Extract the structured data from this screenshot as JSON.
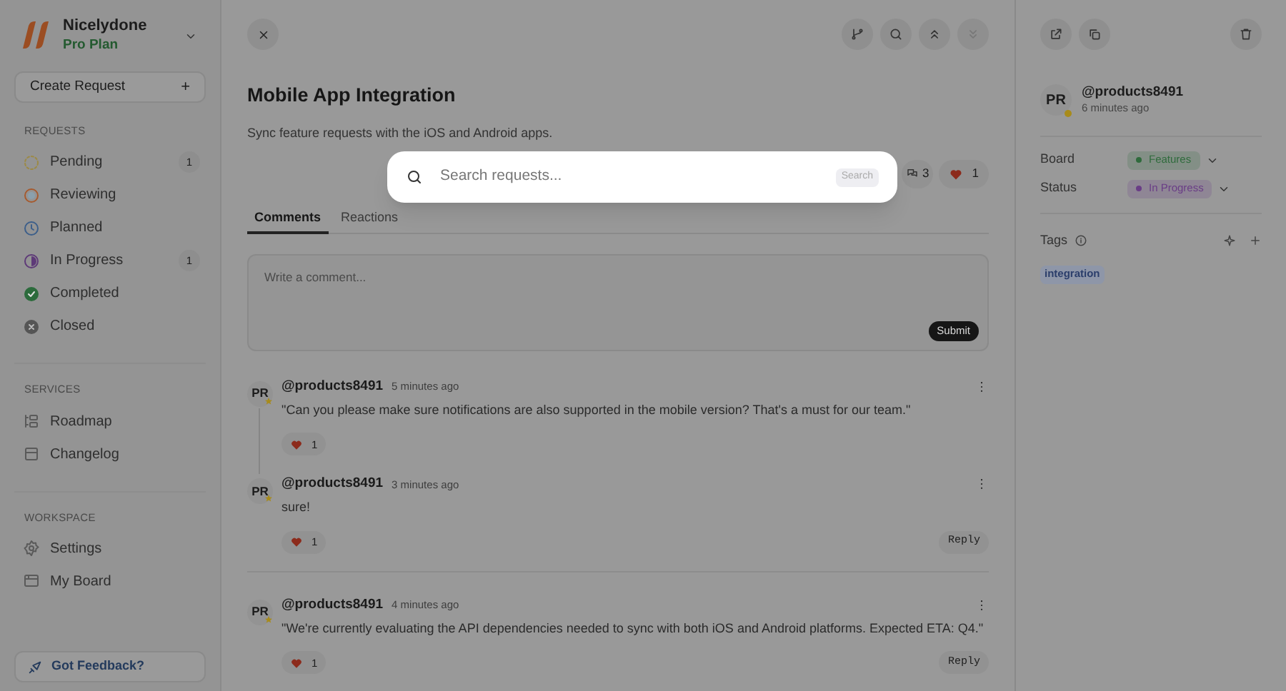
{
  "workspace": {
    "name": "Nicelydone",
    "plan": "Pro Plan"
  },
  "create_button": {
    "label": "Create Request",
    "icon": "+"
  },
  "sections": [
    {
      "title": "REQUESTS",
      "items": [
        {
          "label": "Pending",
          "kind": "pending",
          "count": "1"
        },
        {
          "label": "Reviewing",
          "kind": "reviewing"
        },
        {
          "label": "Planned",
          "kind": "planned"
        },
        {
          "label": "In Progress",
          "kind": "progress",
          "count": "1"
        },
        {
          "label": "Completed",
          "kind": "completed"
        },
        {
          "label": "Closed",
          "kind": "closed"
        }
      ]
    },
    {
      "title": "SERVICES",
      "items": [
        {
          "label": "Roadmap",
          "kind": "roadmap"
        },
        {
          "label": "Changelog",
          "kind": "changelog"
        }
      ]
    },
    {
      "title": "WORKSPACE",
      "items": [
        {
          "label": "Settings",
          "kind": "settings"
        },
        {
          "label": "My Board",
          "kind": "board"
        }
      ]
    }
  ],
  "feedback": "Got Feedback?",
  "request": {
    "title": "Mobile App Integration",
    "description": "Sync feature requests with the iOS and Android apps.",
    "comment_count": "3",
    "likes": "1"
  },
  "tabs": [
    {
      "label": "Comments",
      "selected": true
    },
    {
      "label": "Reactions",
      "selected": false
    }
  ],
  "comment_box": {
    "placeholder": "Write a comment...",
    "submit": "Submit"
  },
  "comments": [
    {
      "avatar": "PR",
      "author": "@products8491",
      "time": "5 minutes ago",
      "text": "\"Can you please make sure notifications are also supported in the mobile version? That's a must for our team.\"",
      "likes": "1",
      "children": [
        {
          "avatar": "PR",
          "author": "@products8491",
          "time": "3 minutes ago",
          "text": "sure!",
          "likes": "1",
          "reply": "Reply"
        }
      ]
    },
    {
      "avatar": "PR",
      "author": "@products8491",
      "time": "4 minutes ago",
      "text": "\"We're currently evaluating the API dependencies needed to sync with both iOS and Android platforms. Expected ETA: Q4.\"",
      "likes": "1",
      "reply": "Reply"
    }
  ],
  "details": {
    "avatar": "PR",
    "author": "@products8491",
    "time": "6 minutes ago",
    "fields": [
      {
        "label": "Board",
        "value": "Features",
        "color": "#2f6b3c"
      },
      {
        "label": "Status",
        "value": "In Progress",
        "color": "#6a3d86"
      }
    ],
    "tags_label": "Tags",
    "tags": [
      "integration"
    ]
  },
  "search": {
    "placeholder": "Search requests...",
    "button": "Search"
  }
}
